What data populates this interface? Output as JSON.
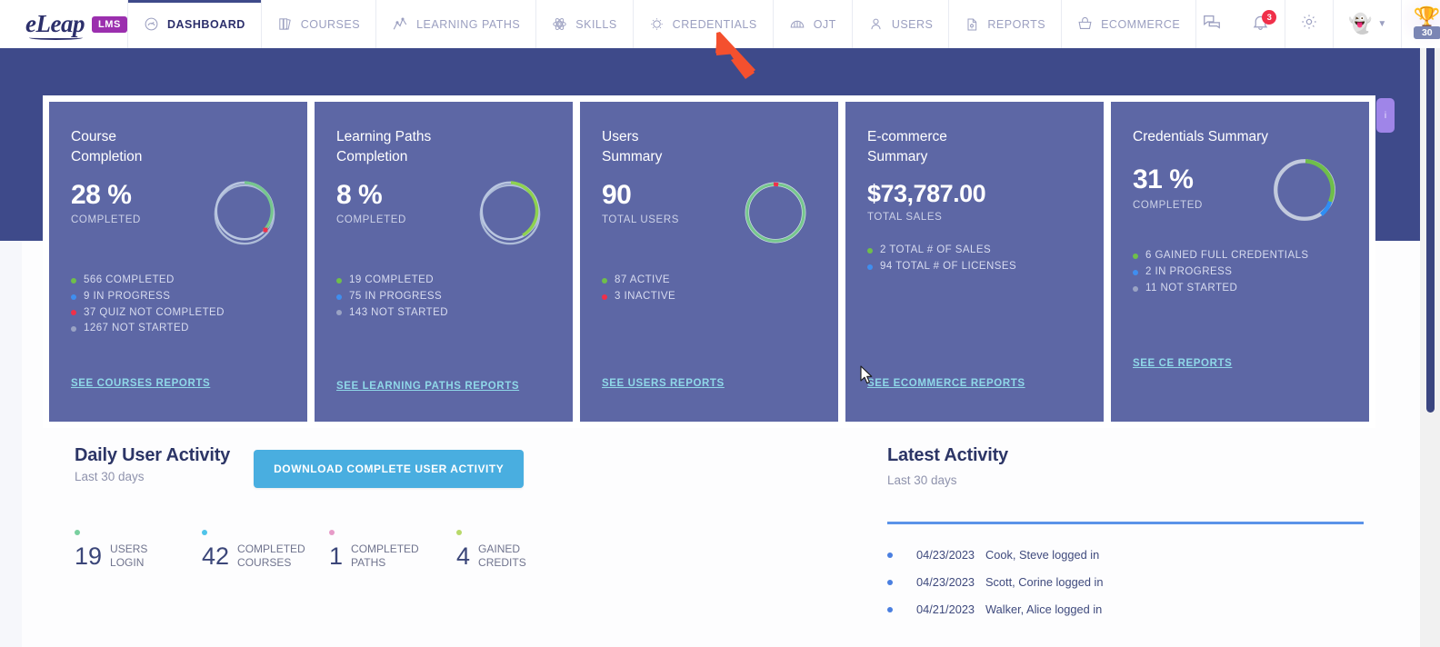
{
  "brand": {
    "name": "eLeap",
    "badge": "LMS"
  },
  "nav": {
    "items": [
      {
        "label": "DASHBOARD",
        "icon": "gauge-icon",
        "active": true
      },
      {
        "label": "COURSES",
        "icon": "books-icon",
        "active": false
      },
      {
        "label": "LEARNING PATHS",
        "icon": "chart-line-icon",
        "active": false
      },
      {
        "label": "SKILLS",
        "icon": "atom-icon",
        "active": false
      },
      {
        "label": "CREDENTIALS",
        "icon": "gear-flower-icon",
        "active": false
      },
      {
        "label": "OJT",
        "icon": "graduation-icon",
        "active": false
      },
      {
        "label": "USERS",
        "icon": "person-icon",
        "active": false
      },
      {
        "label": "REPORTS",
        "icon": "document-icon",
        "active": false
      },
      {
        "label": "ECOMMERCE",
        "icon": "basket-icon",
        "active": false
      }
    ]
  },
  "topright": {
    "messages_icon": "chat-bubbles-icon",
    "notifications_icon": "bell-icon",
    "notifications_count": "3",
    "settings_icon": "gear-icon",
    "avatar_icon": "monster-avatar-icon",
    "avatar_chevron": "chevron-down-icon",
    "trophy_icon": "trophy-icon",
    "trophy_points": "30"
  },
  "side_tab": {
    "label": "i"
  },
  "cards": [
    {
      "title": "Course\nCompletion",
      "value": "28 %",
      "value_label": "COMPLETED",
      "link": "SEE COURSES REPORTS",
      "donut": {
        "type": "donut",
        "segments": [
          {
            "label": "COMPLETED",
            "value": 566,
            "percent": 28,
            "color": "#76c78e"
          },
          {
            "label": "IN PROGRESS",
            "value": 9,
            "percent": 0.4,
            "color": "#3f8ef0"
          },
          {
            "label": "QUIZ NOT COMPLETED",
            "value": 37,
            "percent": 2,
            "color": "#f0304a"
          },
          {
            "label": "NOT STARTED",
            "value": 1267,
            "percent": 69.6,
            "color": "#a9b6d9"
          }
        ]
      },
      "legend": [
        {
          "text": "566 COMPLETED",
          "color": "#6fbf4a"
        },
        {
          "text": "9 IN PROGRESS",
          "color": "#3f8ef0"
        },
        {
          "text": "37 QUIZ NOT COMPLETED",
          "color": "#f0304a"
        },
        {
          "text": "1267 NOT STARTED",
          "color": "#9aa3c4"
        }
      ]
    },
    {
      "title": "Learning Paths\nCompletion",
      "value": "8 %",
      "value_label": "COMPLETED",
      "link": "SEE LEARNING PATHS REPORTS",
      "donut": {
        "type": "donut",
        "segments": [
          {
            "label": "COMPLETED",
            "value": 19,
            "percent": 8,
            "color": "#8ed24f"
          },
          {
            "label": "IN PROGRESS",
            "value": 75,
            "percent": 31.6,
            "color": "#8ed24f"
          },
          {
            "label": "NOT STARTED",
            "value": 143,
            "percent": 60.4,
            "color": "#a9b6d9"
          }
        ]
      },
      "legend": [
        {
          "text": "19 COMPLETED",
          "color": "#6fbf4a"
        },
        {
          "text": "75 IN PROGRESS",
          "color": "#3f8ef0"
        },
        {
          "text": "143 NOT STARTED",
          "color": "#9aa3c4"
        }
      ]
    },
    {
      "title": "Users\nSummary",
      "value": "90",
      "value_label": "TOTAL USERS",
      "link": "SEE USERS REPORTS",
      "donut": {
        "type": "donut",
        "segments": [
          {
            "label": "ACTIVE",
            "value": 87,
            "percent": 96.7,
            "color": "#76c78e"
          },
          {
            "label": "INACTIVE",
            "value": 3,
            "percent": 3.3,
            "color": "#f0304a"
          }
        ]
      },
      "legend": [
        {
          "text": "87 ACTIVE",
          "color": "#6fbf4a"
        },
        {
          "text": "3 INACTIVE",
          "color": "#f0304a"
        }
      ]
    },
    {
      "title": "E-commerce\nSummary",
      "value": "$73,787.00",
      "value_label": "TOTAL SALES",
      "link": "SEE ECOMMERCE REPORTS",
      "donut": null,
      "legend": [
        {
          "text": "2 TOTAL # OF SALES",
          "color": "#6fbf4a"
        },
        {
          "text": "94 TOTAL # OF LICENSES",
          "color": "#3f8ef0"
        }
      ]
    },
    {
      "title": "Credentials Summary",
      "value": "31 %",
      "value_label": "COMPLETED",
      "link": "SEE CE REPORTS",
      "donut": {
        "type": "donut",
        "segments": [
          {
            "label": "GAINED FULL CREDENTIALS",
            "value": 6,
            "percent": 31,
            "color": "#6fbf4a"
          },
          {
            "label": "IN PROGRESS",
            "value": 2,
            "percent": 10.5,
            "color": "#2f8ef5"
          },
          {
            "label": "NOT STARTED",
            "value": 11,
            "percent": 58.5,
            "color": "#b3bcd8"
          }
        ]
      },
      "legend": [
        {
          "text": "6 GAINED FULL CREDENTIALS",
          "color": "#6fbf4a"
        },
        {
          "text": "2 IN PROGRESS",
          "color": "#3f8ef0"
        },
        {
          "text": "11 NOT STARTED",
          "color": "#9aa3c4"
        }
      ]
    }
  ],
  "daily_activity": {
    "title": "Daily User Activity",
    "subtitle": "Last 30 days",
    "download_button": "DOWNLOAD COMPLETE USER ACTIVITY",
    "stats": [
      {
        "number": "19",
        "text": "USERS\nLOGIN",
        "color": "#79cf9f"
      },
      {
        "number": "42",
        "text": "COMPLETED\nCOURSES",
        "color": "#4fc4ea"
      },
      {
        "number": "1",
        "text": "COMPLETED\nPATHS",
        "color": "#e79bc8"
      },
      {
        "number": "4",
        "text": "GAINED\nCREDITS",
        "color": "#b8d96a"
      }
    ]
  },
  "latest_activity": {
    "title": "Latest Activity",
    "subtitle": "Last 30 days",
    "items": [
      {
        "date": "04/23/2023",
        "text": "Cook, Steve logged in"
      },
      {
        "date": "04/23/2023",
        "text": "Scott, Corine logged in"
      },
      {
        "date": "04/21/2023",
        "text": "Walker, Alice logged in"
      }
    ]
  },
  "annotations": {
    "arrow_target": "CREDENTIALS",
    "cursor": "mouse-pointer"
  },
  "colors": {
    "header_band": "#3e4a8a",
    "card_bg": "#5d67a5",
    "accent_link": "#8fd8e8",
    "button": "#49aee0",
    "arrow": "#f4502e"
  }
}
